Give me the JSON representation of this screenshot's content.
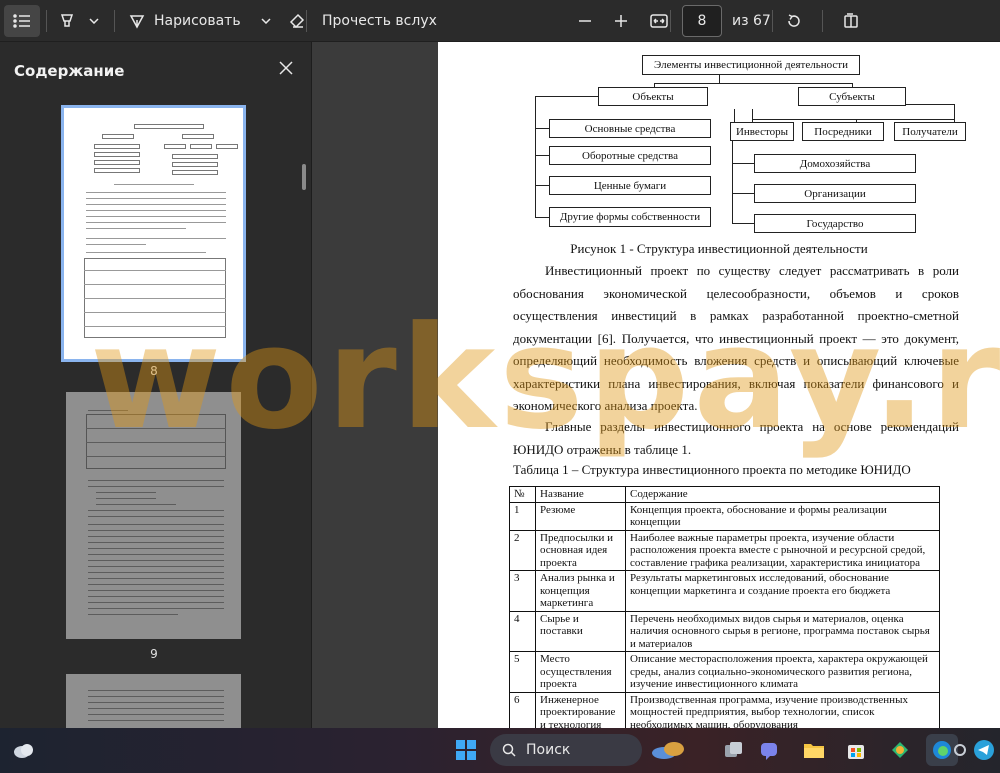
{
  "toolbar": {
    "contents_icon": "list-icon",
    "highlight_icon": "highlighter-icon",
    "chevron_icon": "chevron-down-icon",
    "draw_icon": "pen-icon",
    "draw_label": "Нарисовать",
    "eraser_icon": "eraser-icon",
    "read_aloud_label": "Прочесть вслух",
    "zoom_out_icon": "minus-icon",
    "zoom_in_icon": "plus-icon",
    "fit_icon": "fit-width-icon",
    "page_value": "8",
    "page_total": "из 67",
    "rotate_icon": "rotate-icon",
    "view_icon": "two-page-icon"
  },
  "sidebar": {
    "title": "Содержание",
    "close_icon": "close-icon",
    "thumbnails": [
      {
        "number": "8",
        "selected": true
      },
      {
        "number": "9",
        "selected": false
      }
    ]
  },
  "document": {
    "diagram": {
      "root": "Элементы инвестиционной деятельности",
      "objects": "Объекты",
      "subjects": "Субъекты",
      "object_items": [
        "Основные средства",
        "Оборотные средства",
        "Ценные бумаги",
        "Другие формы собственности"
      ],
      "subject_types": [
        "Инвесторы",
        "Посредники",
        "Получатели"
      ],
      "subject_items": [
        "Домохозяйства",
        "Организации",
        "Государство"
      ]
    },
    "figure_caption": "Рисунок 1 - Структура инвестиционной деятельности",
    "paragraph1": "Инвестиционный проект по существу следует рассматривать в роли обоснования экономической целесообразности, объемов и сроков осуществления инвестиций в рамках разработанной проектно-сметной документации [6]. Получается, что инвестиционный проект — это документ, определяющий необходимость вложения средств и описывающий ключевые характеристики плана инвестирования, включая показатели финансового и экономического анализа проекта.",
    "paragraph2": "Главные разделы инвестиционного проекта на основе рекомендаций ЮНИДО отражены в таблице 1.",
    "table_caption": "Таблица 1 – Структура инвестиционного проекта по методике ЮНИДО",
    "table": {
      "headers": [
        "№",
        "Название",
        "Содержание"
      ],
      "rows": [
        [
          "1",
          "Резюме",
          "Концепция проекта, обоснование и формы реализации концепции"
        ],
        [
          "2",
          "Предпосылки и основная идея проекта",
          "Наиболее важные параметры проекта, изучение области расположения проекта вместе с рыночной и ресурсной средой, составление графика реализации, характеристика инициатора"
        ],
        [
          "3",
          "Анализ рынка и концепция маркетинга",
          "Результаты маркетинговых исследований, обоснование концепции маркетинга и создание проекта его бюджета"
        ],
        [
          "4",
          "Сырье и поставки",
          "Перечень необходимых видов сырья и материалов, оценка наличия основного сырья в регионе, программа поставок сырья и материалов"
        ],
        [
          "5",
          "Место осуществления проекта",
          "Описание месторасположения проекта, характера окружающей среды, анализ социально-экономического развития региона, изучение инвестиционного климата"
        ],
        [
          "6",
          "Инженерное проектирование и технология",
          "Производственная программа, изучение производственных мощностей предприятия, выбор технологии, список необходимых машин, оборудования"
        ]
      ]
    }
  },
  "watermark": "workspay.ru",
  "taskbar": {
    "search_label": "Поиск",
    "icons": [
      "widgets-icon",
      "start-icon",
      "search-icon",
      "weather-icon",
      "task-view-icon",
      "teams-icon",
      "file-explorer-icon",
      "store-icon",
      "photos-icon",
      "edge-icon",
      "settings-icon",
      "telegram-icon"
    ]
  }
}
